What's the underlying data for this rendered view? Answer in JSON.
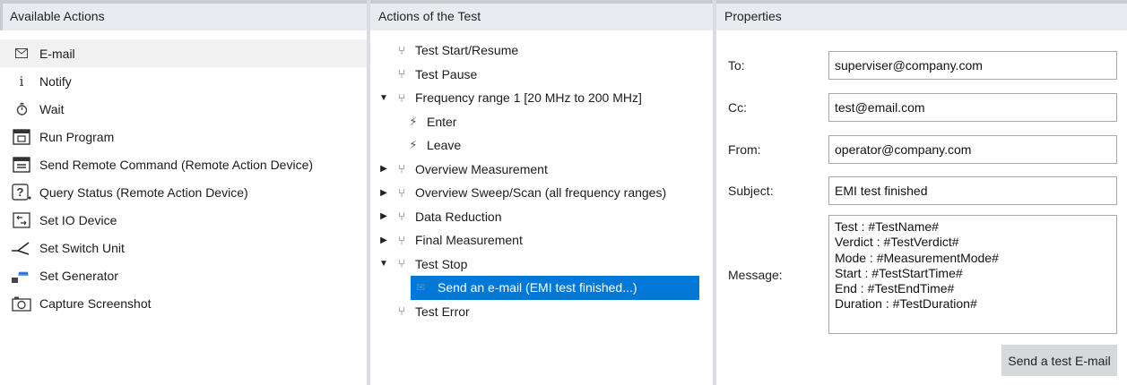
{
  "available": {
    "header": "Available Actions",
    "items": [
      {
        "icon": "envelope-icon",
        "label": "E-mail",
        "selected": true
      },
      {
        "icon": "info-icon",
        "label": "Notify"
      },
      {
        "icon": "timer-icon",
        "label": "Wait"
      },
      {
        "icon": "run-program-icon",
        "label": "Run Program"
      },
      {
        "icon": "remote-command-icon",
        "label": "Send Remote Command (Remote Action Device)"
      },
      {
        "icon": "query-status-icon",
        "label": "Query Status (Remote Action Device)"
      },
      {
        "icon": "io-device-icon",
        "label": "Set IO Device"
      },
      {
        "icon": "switch-icon",
        "label": "Set Switch Unit"
      },
      {
        "icon": "generator-icon",
        "label": "Set Generator"
      },
      {
        "icon": "camera-icon",
        "label": "Capture Screenshot"
      }
    ]
  },
  "actions": {
    "header": "Actions of the Test",
    "tree": [
      {
        "label": "Test Start/Resume",
        "level": 0,
        "toggle": "",
        "icon": "node-icon"
      },
      {
        "label": "Test Pause",
        "level": 0,
        "toggle": "",
        "icon": "node-icon"
      },
      {
        "label": "Frequency range 1 [20 MHz to 200 MHz]",
        "level": 0,
        "toggle": "expanded",
        "icon": "node-icon"
      },
      {
        "label": "Enter",
        "level": 1,
        "toggle": "",
        "icon": "event-icon"
      },
      {
        "label": "Leave",
        "level": 1,
        "toggle": "",
        "icon": "event-icon"
      },
      {
        "label": "Overview Measurement",
        "level": 0,
        "toggle": "collapsed",
        "icon": "node-icon"
      },
      {
        "label": "Overview Sweep/Scan (all frequency ranges)",
        "level": 0,
        "toggle": "collapsed",
        "icon": "node-icon"
      },
      {
        "label": "Data Reduction",
        "level": 0,
        "toggle": "collapsed",
        "icon": "node-icon"
      },
      {
        "label": "Final Measurement",
        "level": 0,
        "toggle": "collapsed",
        "icon": "node-icon"
      },
      {
        "label": "Test Stop",
        "level": 0,
        "toggle": "expanded",
        "icon": "node-icon"
      },
      {
        "label": "Send an e-mail (EMI test finished...)",
        "level": 1,
        "toggle": "",
        "icon": "email-action-icon",
        "selected": true
      },
      {
        "label": "Test Error",
        "level": 0,
        "toggle": "",
        "icon": "node-icon"
      }
    ]
  },
  "properties": {
    "header": "Properties",
    "to_label": "To:",
    "to_value": "superviser@company.com",
    "cc_label": "Cc:",
    "cc_value": "test@email.com",
    "from_label": "From:",
    "from_value": "operator@company.com",
    "subject_label": "Subject:",
    "subject_value": "EMI test finished",
    "message_label": "Message:",
    "message_value": "Test : #TestName#\nVerdict : #TestVerdict#\nMode : #MeasurementMode#\nStart : #TestStartTime#\nEnd : #TestEndTime#\nDuration : #TestDuration#",
    "test_button": "Send a test E-mail"
  },
  "colors": {
    "selection": "#0078d7",
    "header_bg": "#e8ecf1",
    "button_bg": "#d5d9de"
  }
}
